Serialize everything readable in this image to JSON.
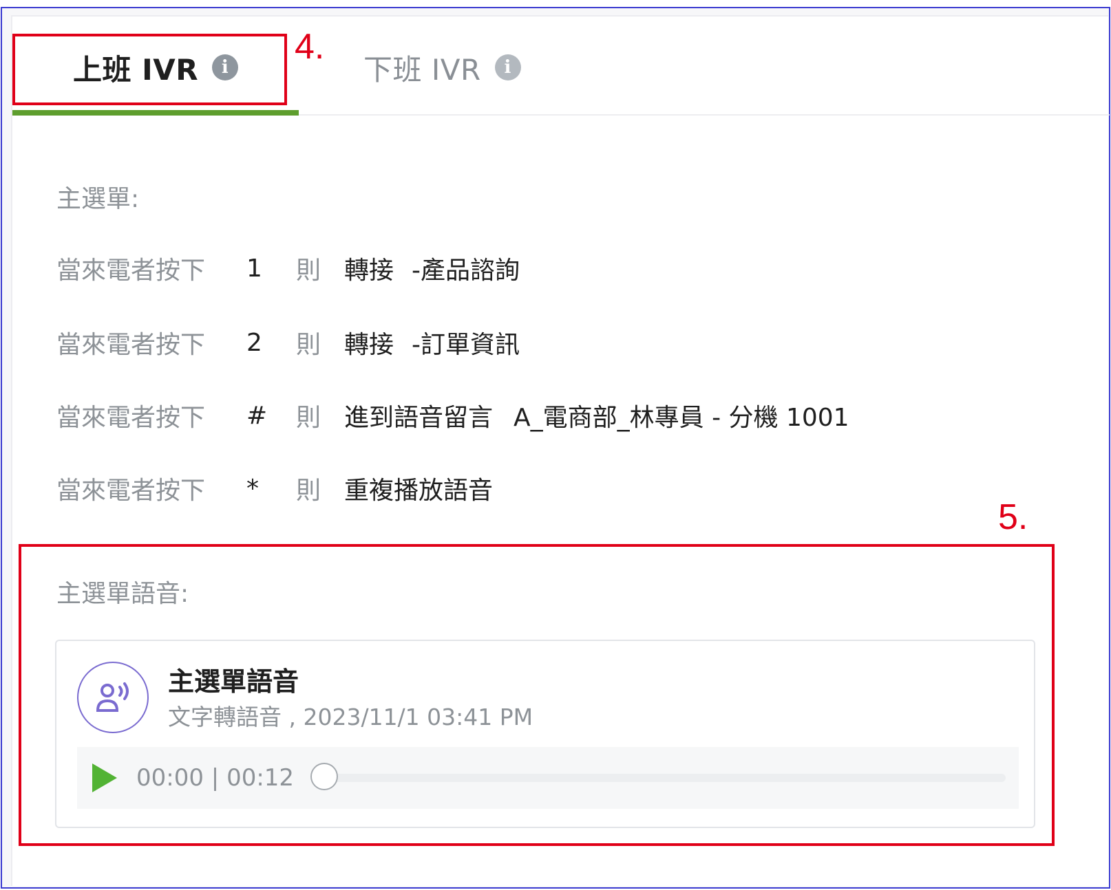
{
  "tabs": [
    {
      "label": "上班 IVR",
      "info_glyph": "i",
      "active": true
    },
    {
      "label": "下班 IVR",
      "info_glyph": "i",
      "active": false
    }
  ],
  "annotations": {
    "label_4": "4.",
    "label_5": "5."
  },
  "main_menu": {
    "title": "主選單:",
    "rules": [
      {
        "prefix": "當來電者按下",
        "key": "1",
        "then": "則",
        "action": "轉接",
        "target": "-產品諮詢"
      },
      {
        "prefix": "當來電者按下",
        "key": "2",
        "then": "則",
        "action": "轉接",
        "target": "-訂單資訊"
      },
      {
        "prefix": "當來電者按下",
        "key": "#",
        "then": "則",
        "action": "進到語音留言",
        "target": "A_電商部_林專員 - 分機 1001"
      },
      {
        "prefix": "當來電者按下",
        "key": "*",
        "then": "則",
        "action": "重複播放語音",
        "target": ""
      }
    ]
  },
  "voice": {
    "title": "主選單語音:",
    "card": {
      "name": "主選單語音",
      "subtitle": "文字轉語音 , 2023/11/1 03:41 PM",
      "icon": "speaking-person-icon",
      "player": {
        "current": "00:00",
        "separator": "|",
        "duration": "00:12",
        "progress": 0.0
      }
    }
  },
  "colors": {
    "accent_underline": "#5e9e2e",
    "play_green": "#52b334",
    "annotation_red": "#e00018",
    "avatar_purple": "#7a6bd0",
    "frame_blue": "#3a3ad0"
  }
}
